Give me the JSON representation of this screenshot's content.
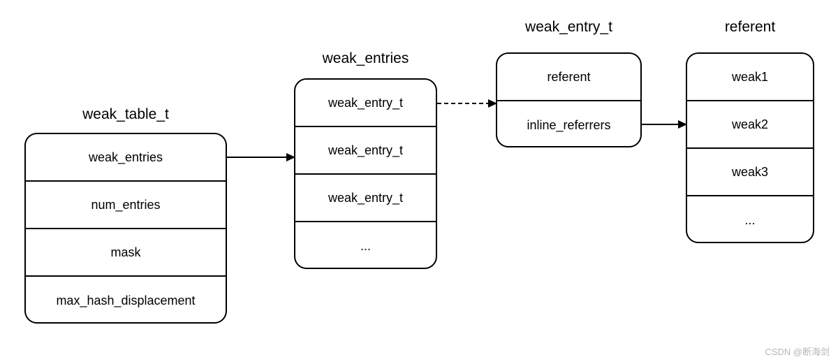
{
  "weak_table_t": {
    "title": "weak_table_t",
    "rows": [
      "weak_entries",
      "num_entries",
      "mask",
      "max_hash_displacement"
    ]
  },
  "weak_entries": {
    "title": "weak_entries",
    "rows": [
      "weak_entry_t",
      "weak_entry_t",
      "weak_entry_t",
      "..."
    ]
  },
  "weak_entry_t": {
    "title": "weak_entry_t",
    "rows": [
      "referent",
      "inline_referrers"
    ]
  },
  "referent": {
    "title": "referent",
    "rows": [
      "weak1",
      "weak2",
      "weak3",
      "..."
    ]
  },
  "watermark": "CSDN @断海剑"
}
